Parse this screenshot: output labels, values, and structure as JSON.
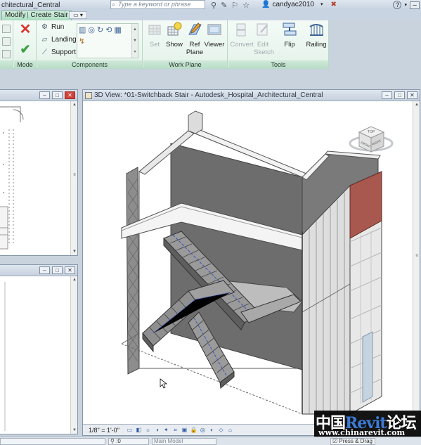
{
  "titlebar": {
    "doc_title": "chitectural_Central",
    "search_placeholder": "Type a keyword or phrase",
    "username": "candyac2010",
    "help": "?"
  },
  "tab": {
    "part1": "Modify",
    "part2": "Create Stair"
  },
  "ribbon": {
    "mode": {
      "label": "Mode"
    },
    "components": {
      "label": "Components",
      "run": "Run",
      "landing": "Landing",
      "support": "Support"
    },
    "work_plane": {
      "label": "Work Plane",
      "set": "Set",
      "show": "Show",
      "ref_plane": "Ref Plane",
      "viewer": "Viewer"
    },
    "tools": {
      "label": "Tools",
      "convert": "Convert",
      "edit_sketch": "Edit Sketch",
      "flip": "Flip",
      "railing": "Railing"
    }
  },
  "view": {
    "title": "3D View: *01-Switchback Stair - Autodesk_Hospital_Architectural_Central",
    "scale": "1/8\" = 1'-0\"",
    "viewcube_left": "FRONT",
    "viewcube_right": "RIGHT",
    "viewcube_top": "TOP"
  },
  "statusbar": {
    "count": ":0",
    "model": "Main Model",
    "press_drag": "Press & Drag"
  },
  "watermark": {
    "cn1": "中国",
    "brand": "Revit",
    "cn2": "论坛",
    "url": "www.chinarevit.com"
  },
  "colors": {
    "ribbon_green": "#e3f2e9",
    "panel_label": "#b7dcc6",
    "accent_red_wall": "#a8584e",
    "stair_gray": "#8a8f96"
  }
}
